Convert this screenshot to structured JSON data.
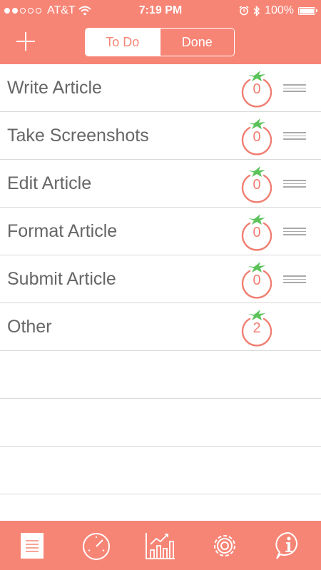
{
  "status_bar": {
    "carrier": "AT&T",
    "time": "7:19 PM",
    "battery": "100%",
    "signal_icon": "signal-dots-icon",
    "wifi_icon": "wifi-icon",
    "alarm_icon": "alarm-icon",
    "bluetooth_icon": "bluetooth-icon"
  },
  "header": {
    "add_icon": "plus-icon",
    "segments": [
      "To Do",
      "Done"
    ],
    "selected_segment": "To Do"
  },
  "tasks": [
    {
      "label": "Write Article",
      "count": "0"
    },
    {
      "label": "Take Screenshots",
      "count": "0"
    },
    {
      "label": "Edit Article",
      "count": "0"
    },
    {
      "label": "Format Article",
      "count": "0"
    },
    {
      "label": "Submit Article",
      "count": "0"
    },
    {
      "label": "Other",
      "count": "2"
    }
  ],
  "tab_bar": {
    "tabs": [
      "list-icon",
      "timer-icon",
      "stats-chart-icon",
      "gear-icon",
      "info-icon"
    ],
    "active": "list-icon"
  },
  "colors": {
    "accent": "#f78576",
    "tomato_red": "#f07e71",
    "leaf_green": "#5cc35b",
    "text_gray": "#666666",
    "divider": "#d9d9d9"
  }
}
